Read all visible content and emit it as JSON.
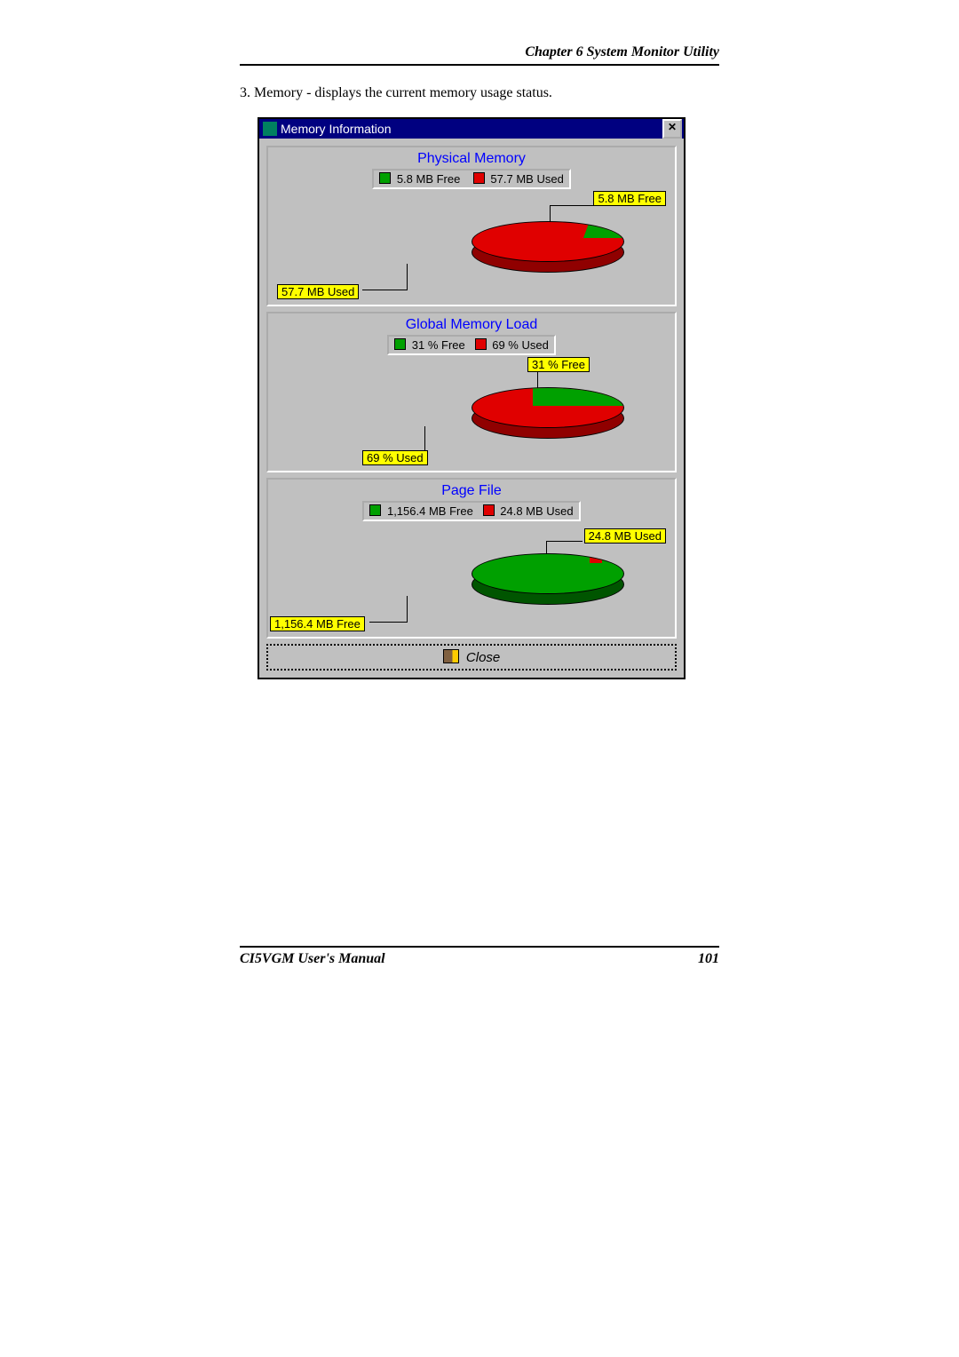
{
  "header": {
    "chapter": "Chapter 6  System Monitor Utility"
  },
  "body": {
    "item3": "3.   Memory - displays the current memory usage status."
  },
  "window": {
    "title": "Memory Information",
    "close_x": "✕",
    "sections": {
      "physical": {
        "title": "Physical Memory",
        "legend_free": "5.8 MB Free",
        "legend_used": "57.7 MB Used",
        "callout_free": "5.8 MB Free",
        "callout_used": "57.7 MB Used"
      },
      "global": {
        "title": "Global Memory Load",
        "legend_free": "31 % Free",
        "legend_used": "69 % Used",
        "callout_free": "31 % Free",
        "callout_used": "69 % Used"
      },
      "pagefile": {
        "title": "Page File",
        "legend_free": "1,156.4 MB Free",
        "legend_used": "24.8 MB Used",
        "callout_free": "1,156.4 MB Free",
        "callout_used": "24.8 MB Used"
      }
    },
    "close_label": "Close"
  },
  "footer": {
    "manual": "CI5VGM User's Manual",
    "page": "101"
  },
  "colors": {
    "free": "#00a000",
    "used": "#e00000"
  },
  "chart_data": [
    {
      "type": "pie",
      "title": "Physical Memory",
      "series": [
        {
          "name": "Free",
          "value": 5.8,
          "unit": "MB",
          "color": "#00a000"
        },
        {
          "name": "Used",
          "value": 57.7,
          "unit": "MB",
          "color": "#e00000"
        }
      ]
    },
    {
      "type": "pie",
      "title": "Global Memory Load",
      "series": [
        {
          "name": "Free",
          "value": 31,
          "unit": "%",
          "color": "#00a000"
        },
        {
          "name": "Used",
          "value": 69,
          "unit": "%",
          "color": "#e00000"
        }
      ]
    },
    {
      "type": "pie",
      "title": "Page File",
      "series": [
        {
          "name": "Free",
          "value": 1156.4,
          "unit": "MB",
          "color": "#00a000"
        },
        {
          "name": "Used",
          "value": 24.8,
          "unit": "MB",
          "color": "#e00000"
        }
      ]
    }
  ]
}
